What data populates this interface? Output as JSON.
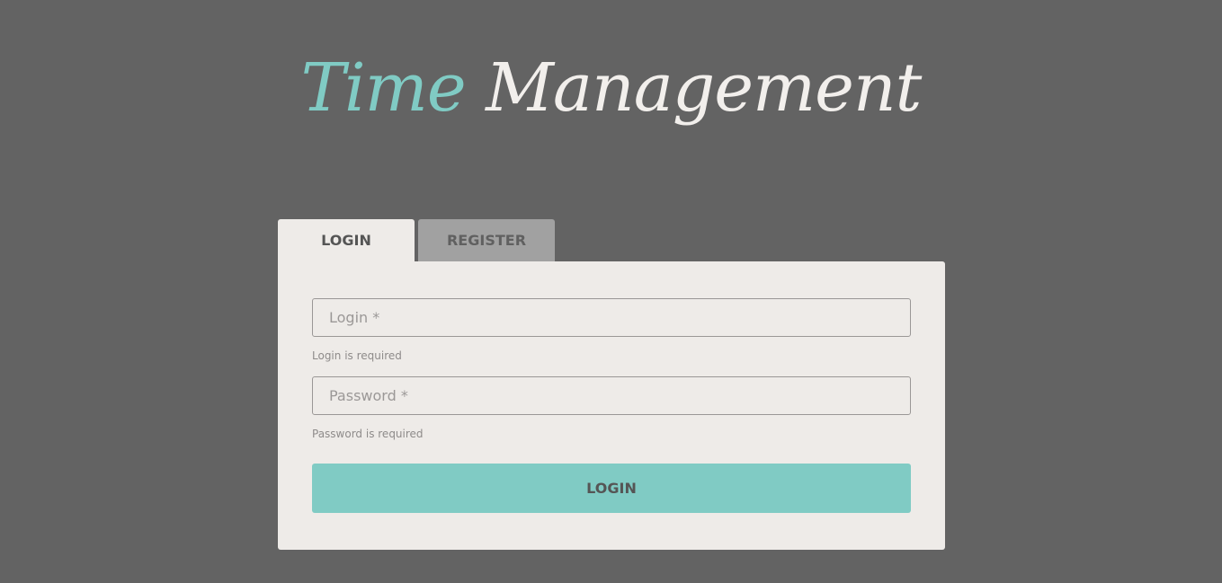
{
  "header": {
    "title_part1": "Time",
    "title_part2": "Management"
  },
  "tabs": [
    {
      "label": "LOGIN",
      "active": true
    },
    {
      "label": "REGISTER",
      "active": false
    }
  ],
  "form": {
    "login_placeholder": "Login *",
    "login_value": "",
    "login_error": "Login is required",
    "password_placeholder": "Password *",
    "password_value": "",
    "password_error": "Password is required",
    "submit_label": "LOGIN"
  },
  "colors": {
    "background": "#636363",
    "accent": "#80cbc4",
    "card": "#eeebe8",
    "tab_inactive": "#a1a1a1"
  }
}
